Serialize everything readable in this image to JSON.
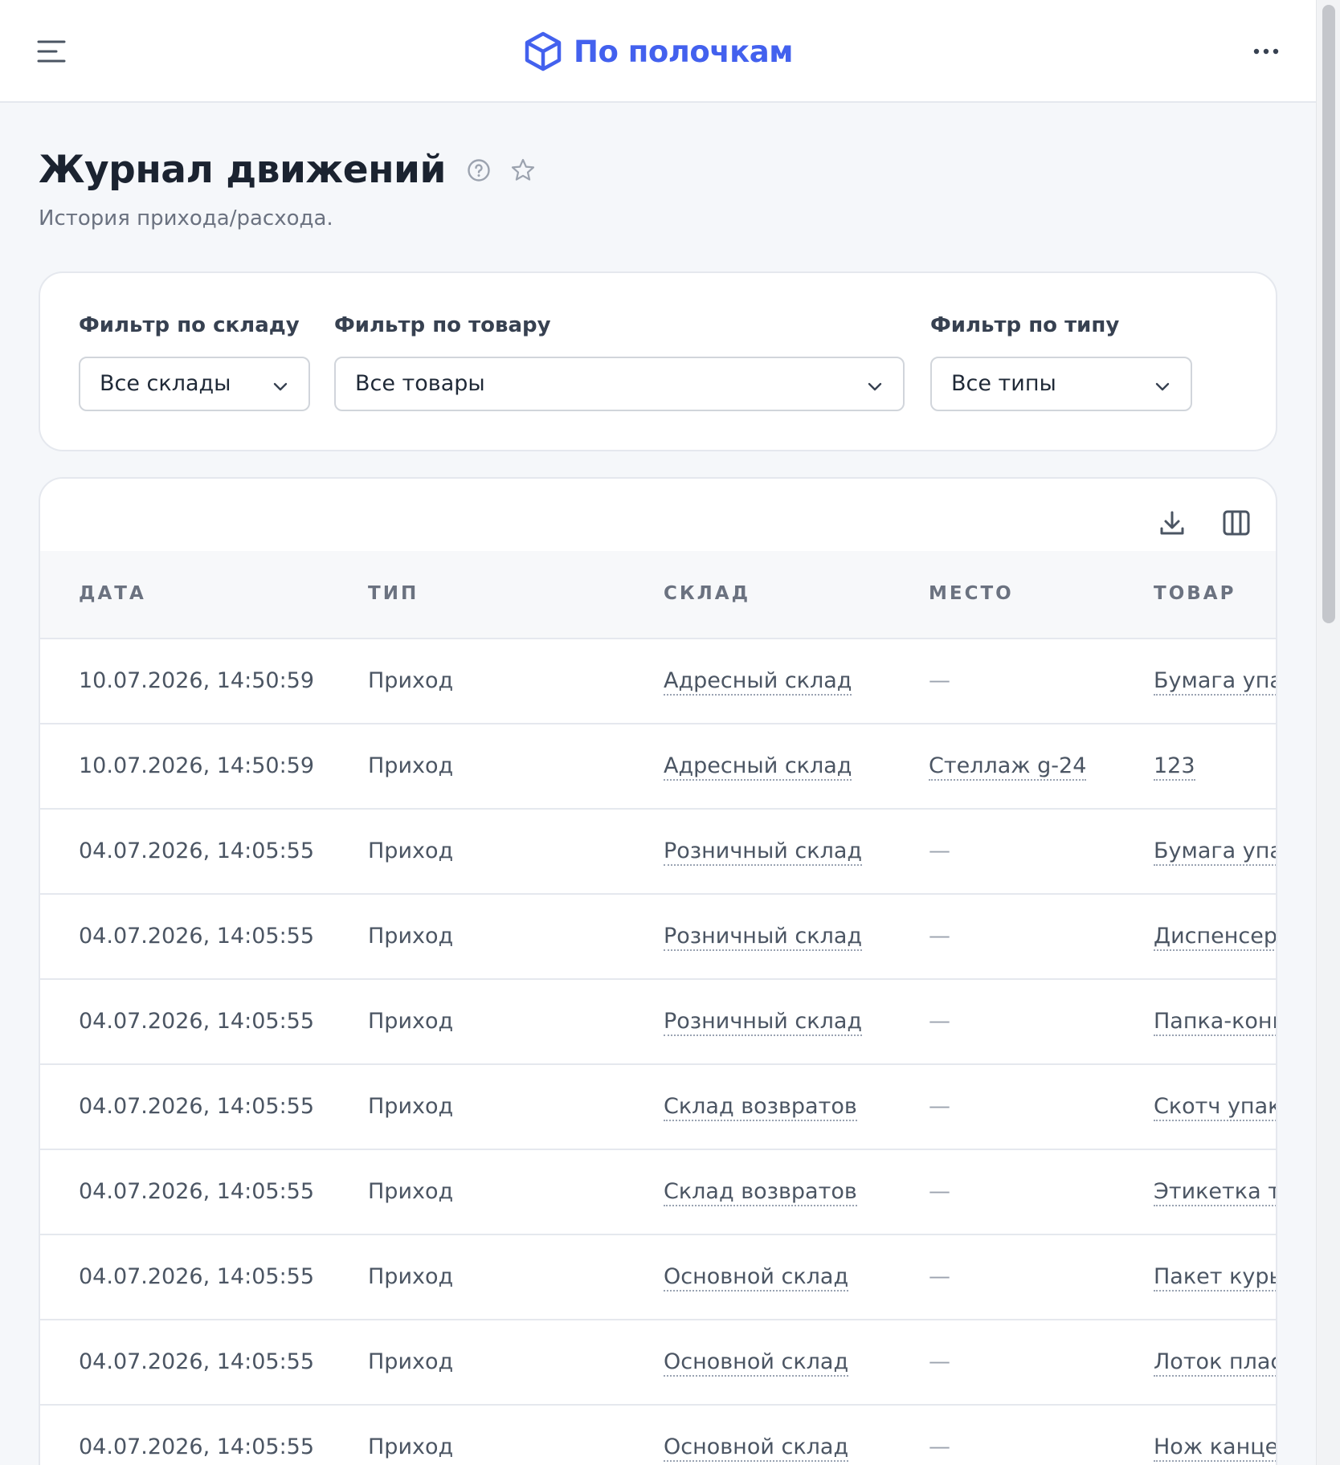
{
  "header": {
    "brand_name": "По полочкам",
    "brand_color": "#4361ee"
  },
  "page": {
    "title": "Журнал движений",
    "subtitle": "История прихода/расхода."
  },
  "filters": {
    "warehouse": {
      "label": "Фильтр по складу",
      "value": "Все склады"
    },
    "product": {
      "label": "Фильтр по товару",
      "value": "Все товары"
    },
    "type": {
      "label": "Фильтр по типу",
      "value": "Все типы"
    }
  },
  "table": {
    "columns": [
      "ДАТА",
      "ТИП",
      "СКЛАД",
      "МЕСТО",
      "ТОВАР"
    ],
    "rows": [
      {
        "date": "10.07.2026, 14:50:59",
        "type": "Приход",
        "warehouse": "Адресный склад",
        "place": "—",
        "product": "Бумага упак"
      },
      {
        "date": "10.07.2026, 14:50:59",
        "type": "Приход",
        "warehouse": "Адресный склад",
        "place": "Стеллаж g-24",
        "product": "123"
      },
      {
        "date": "04.07.2026, 14:05:55",
        "type": "Приход",
        "warehouse": "Розничный склад",
        "place": "—",
        "product": "Бумага упак"
      },
      {
        "date": "04.07.2026, 14:05:55",
        "type": "Приход",
        "warehouse": "Розничный склад",
        "place": "—",
        "product": "Диспенсер"
      },
      {
        "date": "04.07.2026, 14:05:55",
        "type": "Приход",
        "warehouse": "Розничный склад",
        "place": "—",
        "product": "Папка-конв"
      },
      {
        "date": "04.07.2026, 14:05:55",
        "type": "Приход",
        "warehouse": "Склад возвратов",
        "place": "—",
        "product": "Скотч упако"
      },
      {
        "date": "04.07.2026, 14:05:55",
        "type": "Приход",
        "warehouse": "Склад возвратов",
        "place": "—",
        "product": "Этикетка те"
      },
      {
        "date": "04.07.2026, 14:05:55",
        "type": "Приход",
        "warehouse": "Основной склад",
        "place": "—",
        "product": "Пакет курье"
      },
      {
        "date": "04.07.2026, 14:05:55",
        "type": "Приход",
        "warehouse": "Основной склад",
        "place": "—",
        "product": "Лоток пласт"
      },
      {
        "date": "04.07.2026, 14:05:55",
        "type": "Приход",
        "warehouse": "Основной склад",
        "place": "—",
        "product": "Нож канцел"
      }
    ]
  },
  "icons": {
    "menu": "menu-icon",
    "brand": "box-logo-icon",
    "more": "more-dots-icon",
    "help": "help-circle-icon",
    "favorite": "star-icon",
    "download": "download-icon",
    "columns": "columns-icon",
    "dropdown": "chevron-down-icon"
  }
}
